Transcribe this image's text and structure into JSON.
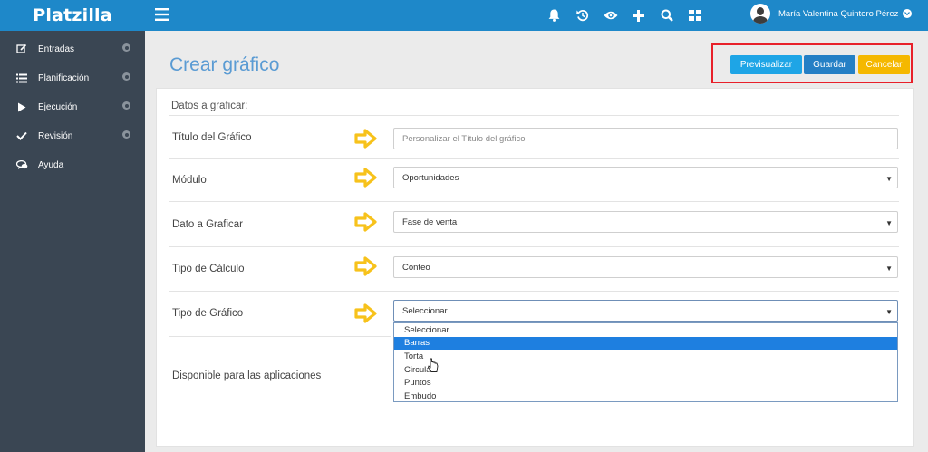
{
  "sidebar": {
    "brand": "Platzilla",
    "items": [
      {
        "label": "Entradas",
        "icon": "edit-icon",
        "settings": true
      },
      {
        "label": "Planificación",
        "icon": "list-icon",
        "settings": true
      },
      {
        "label": "Ejecución",
        "icon": "play-icon",
        "settings": true
      },
      {
        "label": "Revisión",
        "icon": "check-icon",
        "settings": true
      },
      {
        "label": "Ayuda",
        "icon": "chat-icon",
        "settings": false
      }
    ]
  },
  "topbar": {
    "icons": [
      "bell-icon",
      "history-icon",
      "eye-icon",
      "plus-icon",
      "search-icon",
      "dashboard-icon"
    ],
    "user_name": "María Valentina Quintero Pérez"
  },
  "page": {
    "title": "Crear gráfico",
    "buttons": {
      "preview": "Previsualizar",
      "save": "Guardar",
      "cancel": "Cancelar"
    }
  },
  "form": {
    "section_title": "Datos a graficar:",
    "chart_title": {
      "label": "Título del Gráfico",
      "placeholder": "Personalizar el Título del gráfico",
      "value": ""
    },
    "module": {
      "label": "Módulo",
      "value": "Oportunidades"
    },
    "data_field": {
      "label": "Dato a Graficar",
      "value": "Fase de venta"
    },
    "calc_type": {
      "label": "Tipo de Cálculo",
      "value": "Conteo"
    },
    "chart_type": {
      "label": "Tipo de Gráfico",
      "value": "Seleccionar",
      "options": [
        "Seleccionar",
        "Barras",
        "Torta",
        "Circular",
        "Puntos",
        "Embudo"
      ],
      "highlighted": "Barras"
    },
    "apps": {
      "label": "Disponible para las aplicaciones"
    }
  },
  "colors": {
    "sidebar_bg": "#3a4653",
    "topbar_bg": "#1e88c9",
    "title_color": "#5a9bd3",
    "preview_btn": "#1ea5e6",
    "save_btn": "#247fc5",
    "cancel_btn": "#f5b800",
    "annotation_arrow": "#f7c21b",
    "annotation_box": "#e8202a",
    "dropdown_highlight": "#1e7fe0"
  }
}
